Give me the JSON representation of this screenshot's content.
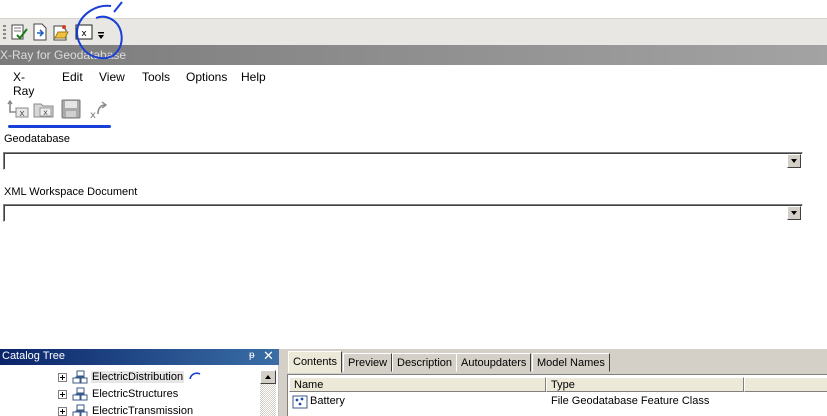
{
  "window": {
    "title": "X-Ray for Geodatabase"
  },
  "top_toolbar": {
    "buttons": [
      {
        "icon": "checklist-icon"
      },
      {
        "icon": "document-arrow-icon"
      },
      {
        "icon": "open-document-icon"
      },
      {
        "icon": "xray-window-icon",
        "glyph": "x"
      }
    ]
  },
  "menu": {
    "items": [
      "X-Ray",
      "Edit",
      "View",
      "Tools",
      "Options",
      "Help"
    ]
  },
  "xray_toolbar": {
    "buttons": [
      {
        "icon": "connect-xray-icon",
        "glyph": "x"
      },
      {
        "icon": "open-xray-icon",
        "glyph": "x"
      },
      {
        "icon": "save-icon"
      },
      {
        "icon": "export-xray-icon",
        "glyph": "x"
      }
    ]
  },
  "form": {
    "geodatabase_label": "Geodatabase",
    "geodatabase_value": "",
    "xml_label": "XML Workspace Document",
    "xml_value": ""
  },
  "catalog": {
    "title": "Catalog Tree",
    "pin_glyph": "ᵽ",
    "close_glyph": "✕",
    "items": [
      {
        "label": "ElectricDistribution",
        "selected": true
      },
      {
        "label": "ElectricStructures",
        "selected": false
      },
      {
        "label": "ElectricTransmission",
        "selected": false
      }
    ]
  },
  "tabs": [
    "Contents",
    "Preview",
    "Description",
    "Autoupdaters",
    "Model Names"
  ],
  "contents_table": {
    "columns": [
      "Name",
      "Type"
    ],
    "rows": [
      {
        "name": "Battery",
        "type": "File Geodatabase Feature Class"
      }
    ]
  },
  "colors": {
    "annotation": "#1a3fd6",
    "title_bar": "#8a8a8a",
    "catalog_header": "#0a246a"
  }
}
